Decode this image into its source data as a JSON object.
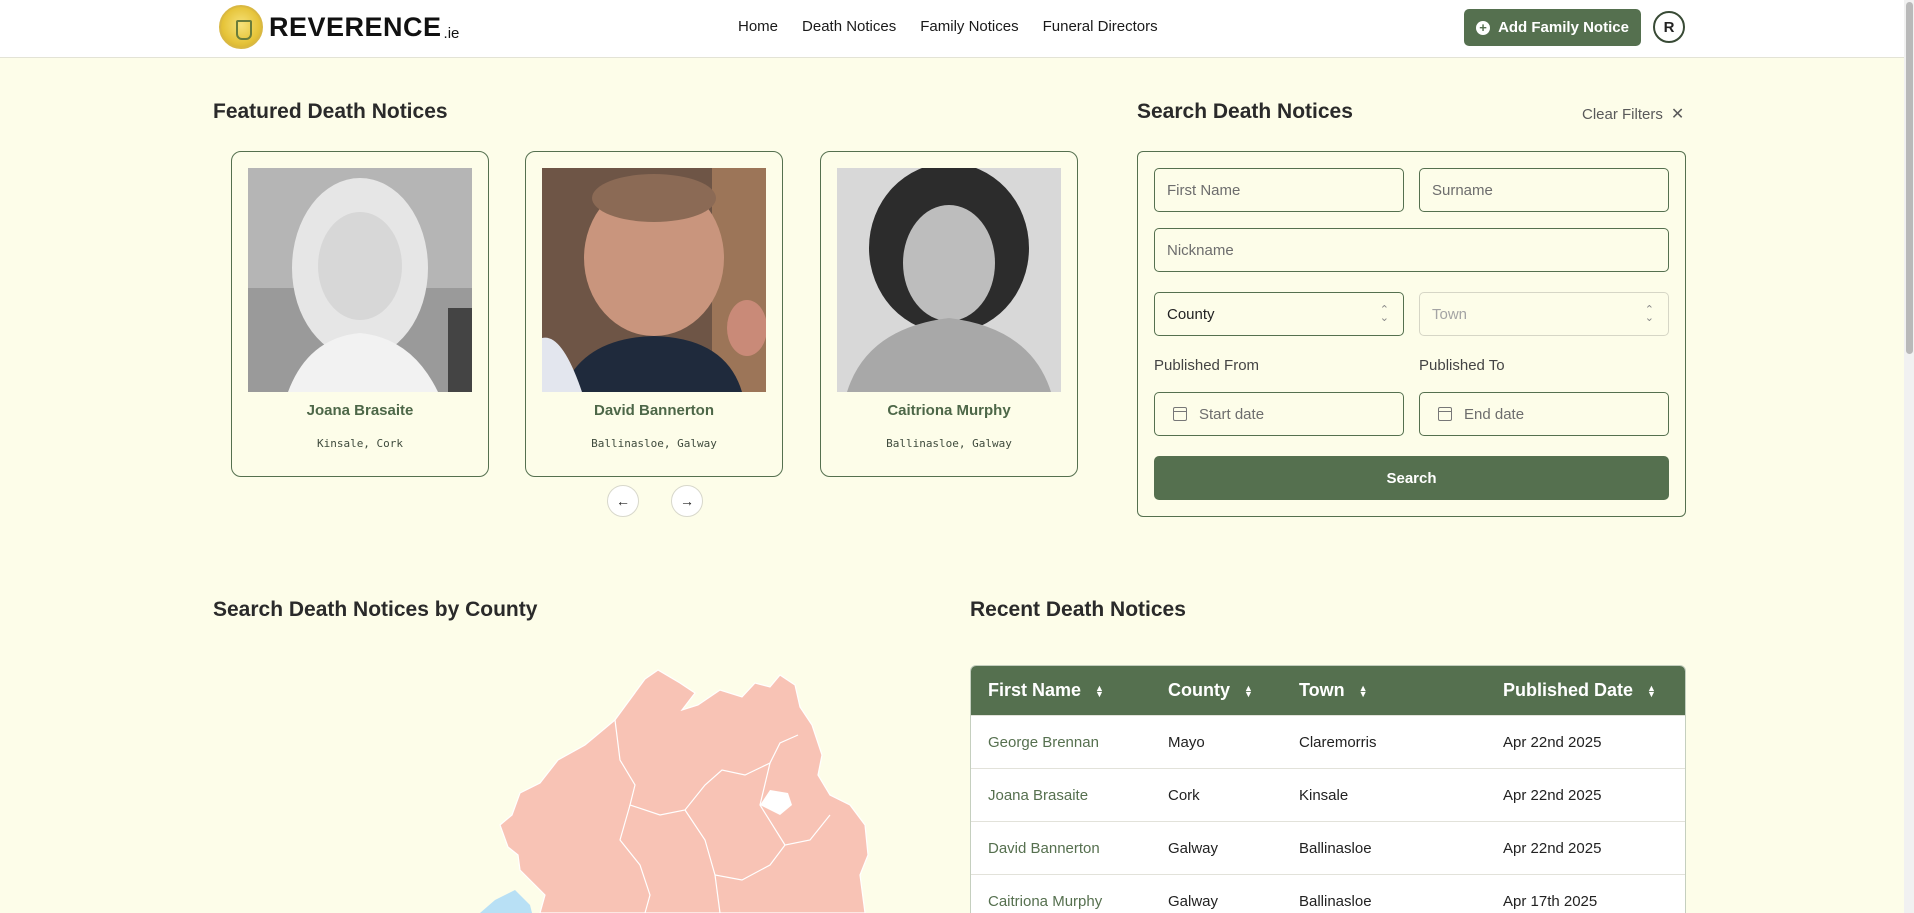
{
  "header": {
    "logo_text": "REVERENCE",
    "logo_suffix": ".ie",
    "nav": [
      "Home",
      "Death Notices",
      "Family Notices",
      "Funeral Directors"
    ],
    "add_button": "Add Family Notice",
    "avatar_initial": "R"
  },
  "featured": {
    "title": "Featured Death Notices",
    "cards": [
      {
        "name": "Joana Brasaite",
        "location": "Kinsale, Cork"
      },
      {
        "name": "David Bannerton",
        "location": "Ballinasloe, Galway"
      },
      {
        "name": "Caitriona Murphy",
        "location": "Ballinasloe, Galway"
      }
    ]
  },
  "search": {
    "title": "Search Death Notices",
    "clear_label": "Clear Filters",
    "first_name_placeholder": "First Name",
    "surname_placeholder": "Surname",
    "nickname_placeholder": "Nickname",
    "county_value": "County",
    "town_value": "Town",
    "published_from_label": "Published From",
    "published_to_label": "Published To",
    "start_placeholder": "Start date",
    "end_placeholder": "End date",
    "search_button": "Search"
  },
  "map_section": {
    "title": "Search Death Notices by County"
  },
  "recent": {
    "title": "Recent Death Notices",
    "columns": [
      "First Name",
      "County",
      "Town",
      "Published Date"
    ],
    "rows": [
      {
        "name": "George Brennan",
        "county": "Mayo",
        "town": "Claremorris",
        "date": "Apr 22nd 2025"
      },
      {
        "name": "Joana Brasaite",
        "county": "Cork",
        "town": "Kinsale",
        "date": "Apr 22nd 2025"
      },
      {
        "name": "David Bannerton",
        "county": "Galway",
        "town": "Ballinasloe",
        "date": "Apr 22nd 2025"
      },
      {
        "name": "Caitriona Murphy",
        "county": "Galway",
        "town": "Ballinasloe",
        "date": "Apr 17th 2025"
      }
    ]
  },
  "colors": {
    "brand": "#55704f",
    "page_bg": "#fdfde9",
    "map_fill": "#f8c3b5",
    "map_water": "#b8e0f5"
  }
}
